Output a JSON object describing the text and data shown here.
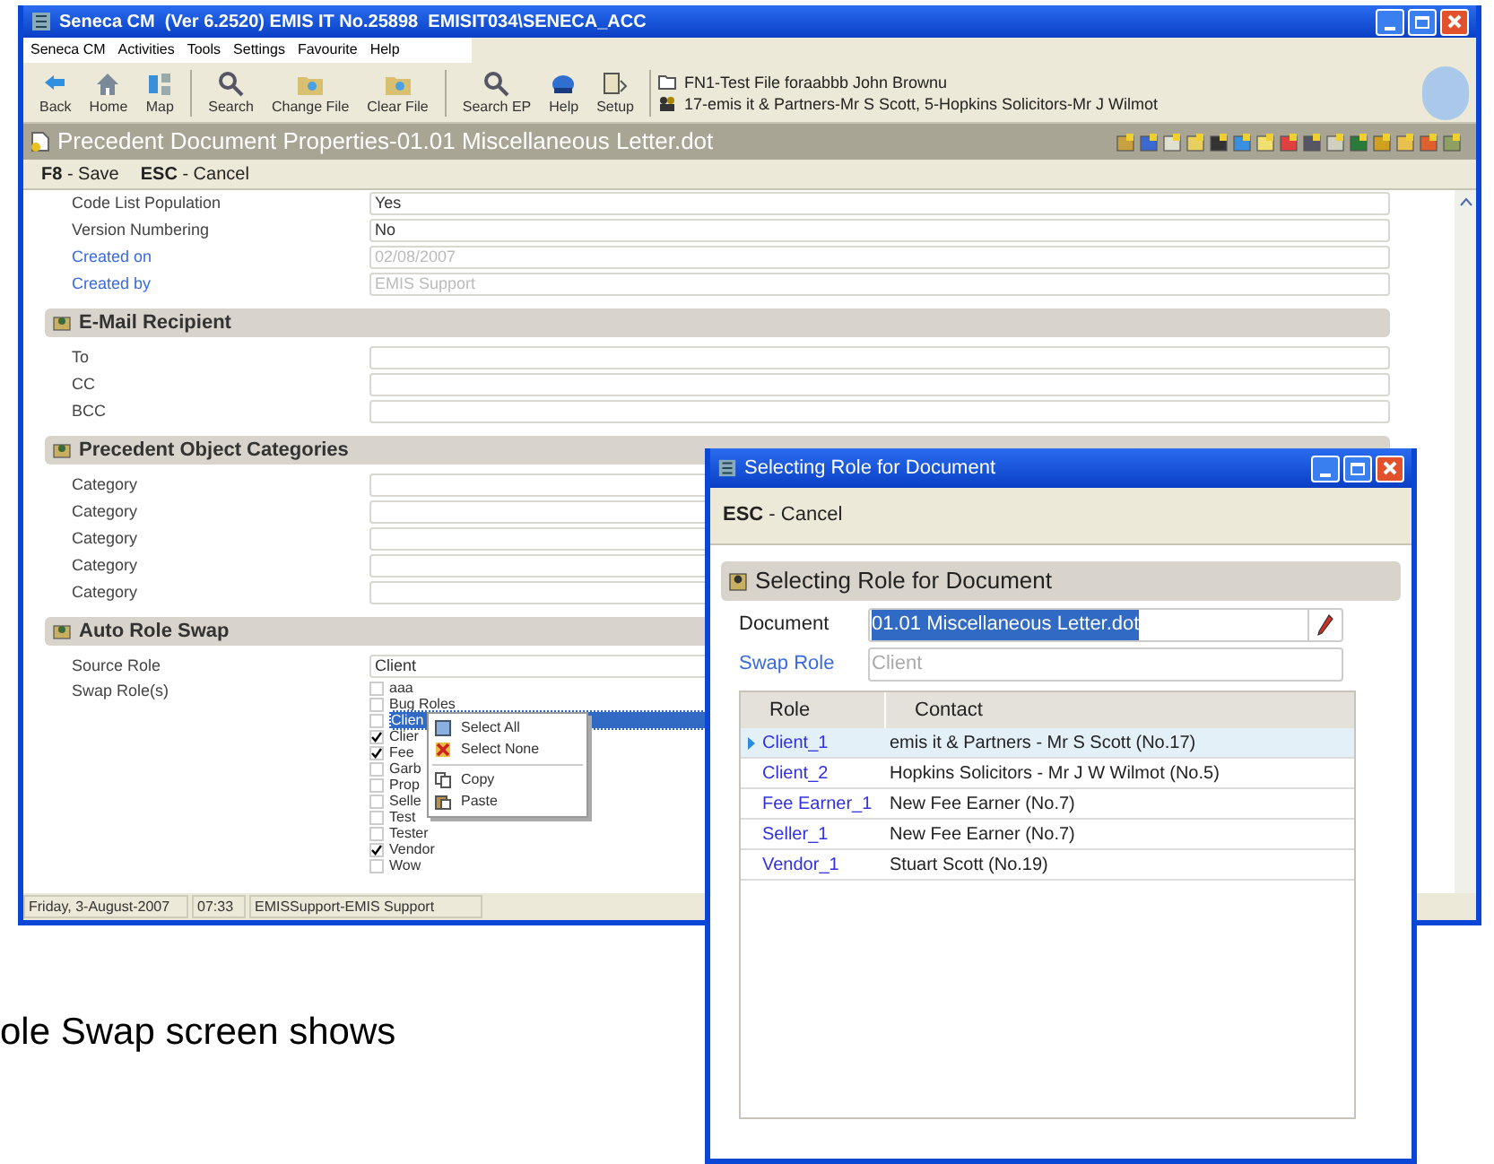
{
  "main_window": {
    "title": "Seneca CM  (Ver 6.2520) EMIS IT No.25898  EMISIT034\\SENECA_ACC",
    "menu": [
      "Seneca CM",
      "Activities",
      "Tools",
      "Settings",
      "Favourite",
      "Help"
    ],
    "toolbar_groups": [
      [
        {
          "label": "Back",
          "kind": "back"
        },
        {
          "label": "Home",
          "kind": "home"
        },
        {
          "label": "Map",
          "kind": "map"
        }
      ],
      [
        {
          "label": "Search",
          "kind": "search"
        },
        {
          "label": "Change File",
          "kind": "folder"
        },
        {
          "label": "Clear File",
          "kind": "folder"
        }
      ],
      [
        {
          "label": "Search EP",
          "kind": "search"
        },
        {
          "label": "Help",
          "kind": "help"
        },
        {
          "label": "Setup",
          "kind": "setup"
        }
      ]
    ],
    "file_info": {
      "file": "FN1-Test File foraabbb John Brownu",
      "parties": "17-emis it & Partners-Mr S Scott, 5-Hopkins Solicitors-Mr J Wilmot"
    },
    "document_title": "Precedent Document Properties-01.01 Miscellaneous Letter.dot",
    "shortcuts": [
      {
        "key": "F8",
        "separator": "-",
        "label": "Save"
      },
      {
        "key": "ESC",
        "separator": "-",
        "label": "Cancel"
      }
    ],
    "property_rows": [
      {
        "label": "Code List Population",
        "value": "Yes",
        "readonly": false
      },
      {
        "label": "Version Numbering",
        "value": "No",
        "readonly": false
      },
      {
        "label": "Created on",
        "value": "02/08/2007",
        "readonly": true
      },
      {
        "label": "Created by",
        "value": "EMIS Support",
        "readonly": true
      }
    ],
    "sections": [
      {
        "title": "E-Mail Recipient",
        "rows": [
          {
            "label": "To"
          },
          {
            "label": "CC"
          },
          {
            "label": "BCC"
          }
        ]
      },
      {
        "title": "Precedent Object Categories",
        "rows": [
          {
            "label": "Category"
          },
          {
            "label": "Category"
          },
          {
            "label": "Category"
          },
          {
            "label": "Category"
          },
          {
            "label": "Category"
          }
        ]
      }
    ],
    "auto_role_swap": {
      "title": "Auto Role Swap",
      "source_label": "Source Role",
      "source_value": "Client",
      "swap_label": "Swap Role(s)",
      "roles": [
        {
          "label": "aaa",
          "checked": false,
          "selected": false
        },
        {
          "label": "Bug Roles",
          "checked": false,
          "selected": false
        },
        {
          "label": "Clien",
          "checked": false,
          "selected": true
        },
        {
          "label": "Clier",
          "checked": true,
          "selected": false
        },
        {
          "label": "Fee",
          "checked": true,
          "selected": false
        },
        {
          "label": "Garb",
          "checked": false,
          "selected": false
        },
        {
          "label": "Prop",
          "checked": false,
          "selected": false
        },
        {
          "label": "Selle",
          "checked": false,
          "selected": false
        },
        {
          "label": "Test",
          "checked": false,
          "selected": false
        },
        {
          "label": "Tester",
          "checked": false,
          "selected": false
        },
        {
          "label": "Vendor",
          "checked": true,
          "selected": false
        },
        {
          "label": "Wow",
          "checked": false,
          "selected": false
        }
      ]
    },
    "context_menu": [
      {
        "kind": "select_all",
        "label": "Select All"
      },
      {
        "kind": "select_none",
        "label": "Select None"
      },
      {
        "kind": "separator"
      },
      {
        "kind": "copy",
        "label": "Copy"
      },
      {
        "kind": "paste",
        "label": "Paste"
      }
    ],
    "status_bar": [
      "Friday, 3-August-2007",
      "07:33",
      "EMISSupport-EMIS Support"
    ]
  },
  "dialog": {
    "title": "Selecting Role for Document",
    "shortcuts": [
      {
        "key": "ESC",
        "separator": "-",
        "label": "Cancel"
      }
    ],
    "section_title": "Selecting Role for Document",
    "fields": [
      {
        "label": "Document",
        "value": "01.01 Miscellaneous Letter.dot",
        "readonly": false,
        "text_selected": true,
        "editable": true
      },
      {
        "label": "Swap Role",
        "value": "Client",
        "readonly": true,
        "text_selected": false,
        "editable": false
      }
    ],
    "columns": [
      "Role",
      "Contact"
    ],
    "rows": [
      {
        "role": "Client_1",
        "contact": "emis it & Partners - Mr S Scott (No.17)",
        "selected": true
      },
      {
        "role": "Client_2",
        "contact": "Hopkins Solicitors - Mr J W Wilmot (No.5)",
        "selected": false
      },
      {
        "role": "Fee Earner_1",
        "contact": "New Fee Earner (No.7)",
        "selected": false
      },
      {
        "role": "Seller_1",
        "contact": "New Fee Earner (No.7)",
        "selected": false
      },
      {
        "role": "Vendor_1",
        "contact": "Stuart Scott (No.19)",
        "selected": false
      }
    ]
  },
  "caption": "ole Swap screen shows"
}
